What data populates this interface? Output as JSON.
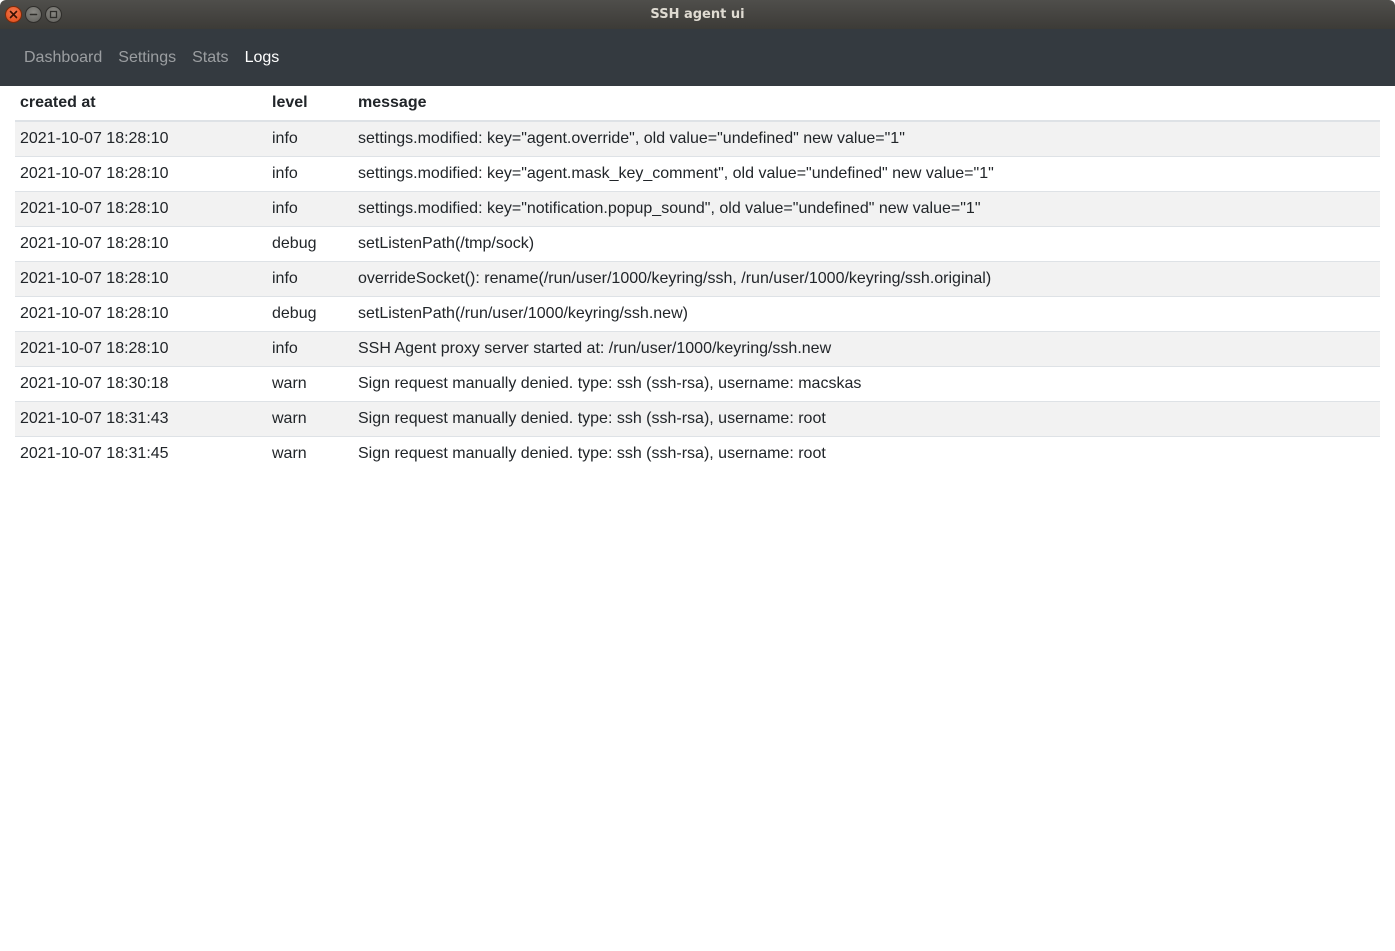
{
  "window": {
    "title": "SSH agent ui"
  },
  "nav": {
    "items": [
      {
        "label": "Dashboard",
        "active": false
      },
      {
        "label": "Settings",
        "active": false
      },
      {
        "label": "Stats",
        "active": false
      },
      {
        "label": "Logs",
        "active": true
      }
    ]
  },
  "table": {
    "headers": [
      "created at",
      "level",
      "message"
    ],
    "rows": [
      {
        "created_at": "2021-10-07 18:28:10",
        "level": "info",
        "message": "settings.modified: key=\"agent.override\", old value=\"undefined\" new value=\"1\""
      },
      {
        "created_at": "2021-10-07 18:28:10",
        "level": "info",
        "message": "settings.modified: key=\"agent.mask_key_comment\", old value=\"undefined\" new value=\"1\""
      },
      {
        "created_at": "2021-10-07 18:28:10",
        "level": "info",
        "message": "settings.modified: key=\"notification.popup_sound\", old value=\"undefined\" new value=\"1\""
      },
      {
        "created_at": "2021-10-07 18:28:10",
        "level": "debug",
        "message": "setListenPath(/tmp/sock)"
      },
      {
        "created_at": "2021-10-07 18:28:10",
        "level": "info",
        "message": "overrideSocket(): rename(/run/user/1000/keyring/ssh, /run/user/1000/keyring/ssh.original)"
      },
      {
        "created_at": "2021-10-07 18:28:10",
        "level": "debug",
        "message": "setListenPath(/run/user/1000/keyring/ssh.new)"
      },
      {
        "created_at": "2021-10-07 18:28:10",
        "level": "info",
        "message": "SSH Agent proxy server started at: /run/user/1000/keyring/ssh.new"
      },
      {
        "created_at": "2021-10-07 18:30:18",
        "level": "warn",
        "message": "Sign request manually denied. type: ssh (ssh-rsa), username: macskas"
      },
      {
        "created_at": "2021-10-07 18:31:43",
        "level": "warn",
        "message": "Sign request manually denied. type: ssh (ssh-rsa), username: root"
      },
      {
        "created_at": "2021-10-07 18:31:45",
        "level": "warn",
        "message": "Sign request manually denied. type: ssh (ssh-rsa), username: root"
      }
    ]
  },
  "colors": {
    "navbar_bg": "#343a40",
    "row_stripe": "#f2f2f2",
    "close_button": "#df4a16"
  }
}
